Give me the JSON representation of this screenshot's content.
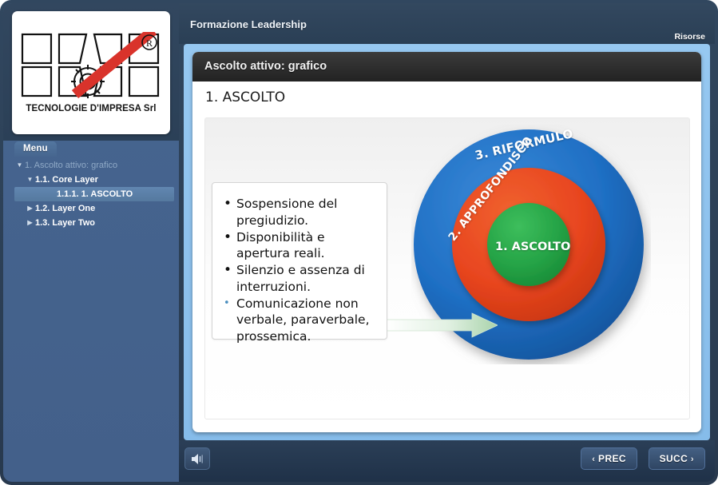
{
  "branding": {
    "logo_text": "TECNOLOGIE D'IMPRESA Srl",
    "registered_mark": "®"
  },
  "header": {
    "course_title": "Formazione Leadership",
    "resources_label": "Risorse"
  },
  "sidebar": {
    "menu_tab_label": "Menu",
    "tree": [
      {
        "level": 1,
        "label": "1. Ascolto attivo: grafico",
        "arrow": "▼",
        "expanded": true,
        "selected": false
      },
      {
        "level": 2,
        "label": "1.1. Core Layer",
        "arrow": "▼",
        "expanded": true,
        "selected": false
      },
      {
        "level": 3,
        "label": "1.1.1. 1. ASCOLTO",
        "arrow": "",
        "expanded": false,
        "selected": true
      },
      {
        "level": 2,
        "label": "1.2. Layer One",
        "arrow": "▶",
        "expanded": false,
        "selected": false
      },
      {
        "level": 2,
        "label": "1.3. Layer Two",
        "arrow": "▶",
        "expanded": false,
        "selected": false
      }
    ]
  },
  "slide": {
    "title": "Ascolto attivo: grafico",
    "heading": "1. ASCOLTO",
    "bullets": [
      "Sospensione del pregiudizio.",
      "Disponibilità e apertura reali.",
      "Silenzio e assenza di interruzioni.",
      "Comunicazione non verbale, paraverbale, prossemica."
    ],
    "diagram": {
      "outer_label": "3. RIFORMULO",
      "middle_label": "2. APPROFONDISCO",
      "core_label": "1. ASCOLTO",
      "outer_color": "#1f6fc4",
      "middle_color": "#e8451f",
      "core_color": "#25a346",
      "arrow_color": "#cde8cf"
    }
  },
  "controls": {
    "audio_icon": "speaker-icon",
    "prev_label": "PREC",
    "next_label": "SUCC",
    "prev_chevron": "‹",
    "next_chevron": "›"
  }
}
